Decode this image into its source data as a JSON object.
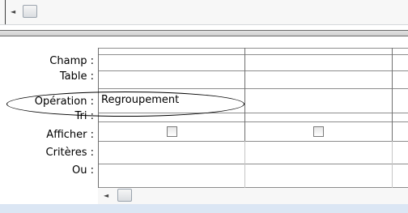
{
  "top_scrollbar": {
    "left_arrow_icon": "triangle-left",
    "thumb_icon": "scroll-thumb"
  },
  "grid": {
    "row_labels": [
      "Champ :",
      "Table :",
      "Opération :",
      "Tri :",
      "Afficher :",
      "Critères :",
      "Ou :"
    ],
    "columns": [
      {
        "champ": "",
        "table": "",
        "operation": "Regroupement",
        "tri": "",
        "afficher": false,
        "criteres": "",
        "ou": ""
      },
      {
        "champ": "",
        "table": "",
        "operation": "",
        "tri": "",
        "afficher": false,
        "criteres": "",
        "ou": ""
      },
      {
        "champ": "",
        "table": "",
        "operation": "",
        "tri": "",
        "afficher": false,
        "criteres": "",
        "ou": ""
      }
    ]
  },
  "bottom_scrollbar": {
    "left_arrow_icon": "triangle-left",
    "thumb_icon": "scroll-thumb"
  },
  "annotation": {
    "shape": "ellipse",
    "color": "#000000",
    "highlights": "Opération row"
  }
}
